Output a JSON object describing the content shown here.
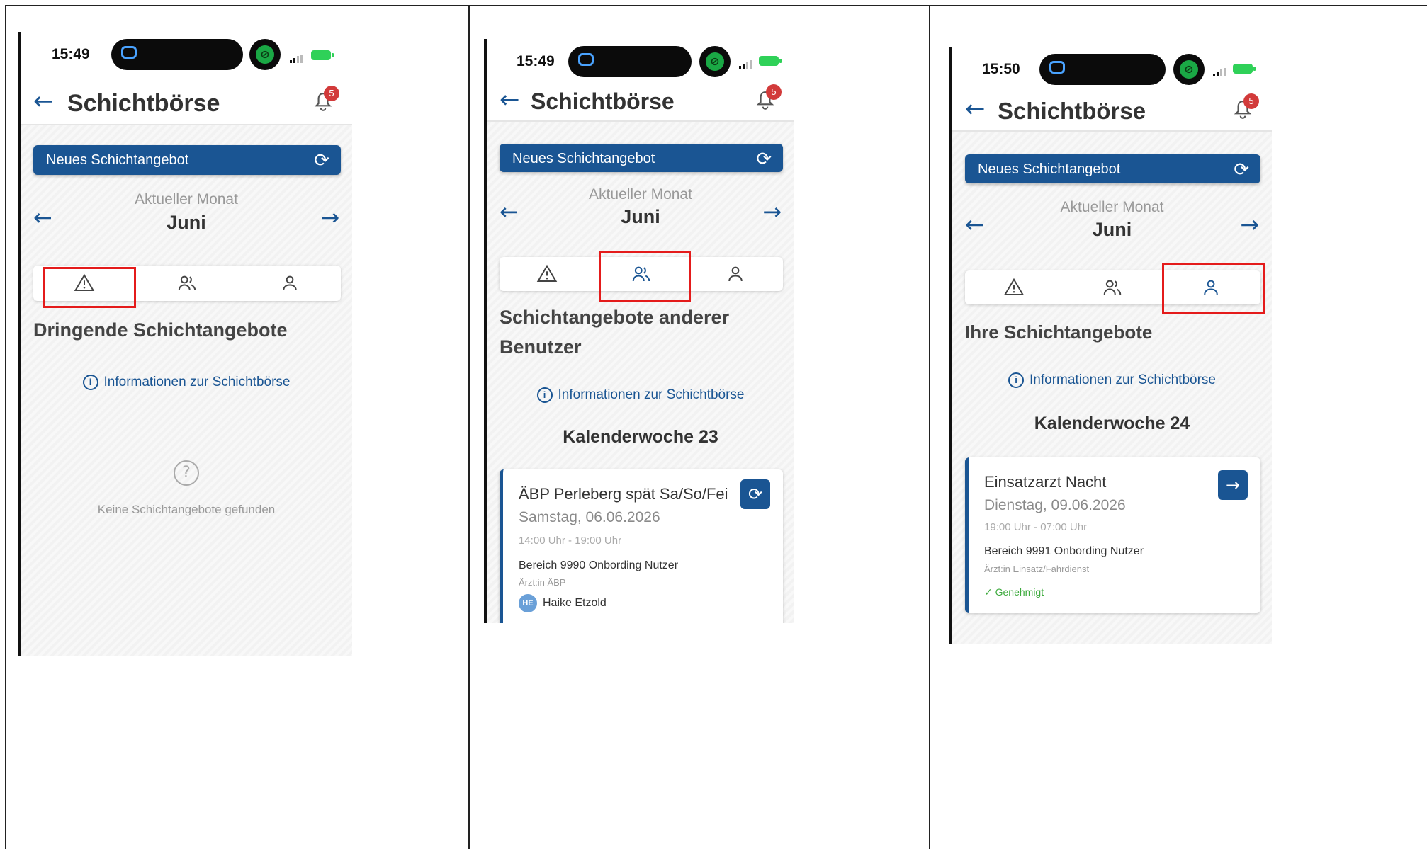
{
  "panels": [
    {
      "status": {
        "time": "15:49"
      },
      "header": {
        "title": "Schichtbörse",
        "badge": "5"
      },
      "new_button": "Neues Schichtangebot",
      "month_caption": "Aktueller Monat",
      "month": "Juni",
      "section_title": "Dringende Schichtangebote",
      "info_link": "Informationen zur Schichtbörse",
      "empty_text": "Keine Schichtangebote gefunden",
      "selected_tab": "urgent"
    },
    {
      "status": {
        "time": "15:49"
      },
      "header": {
        "title": "Schichtbörse",
        "badge": "5"
      },
      "new_button": "Neues Schichtangebot",
      "month_caption": "Aktueller Monat",
      "month": "Juni",
      "section_title_1": "Schichtangebote anderer",
      "section_title_2": "Benutzer",
      "info_link": "Informationen zur Schichtbörse",
      "week": "Kalenderwoche 23",
      "card": {
        "title": "ÄBP Perleberg spät Sa/So/Fei",
        "date": "Samstag, 06.06.2026",
        "time": "14:00 Uhr - 19:00 Uhr",
        "area": "Bereich 9990 Onbording Nutzer",
        "role": "Ärzt:in ÄBP",
        "user_initials": "HE",
        "user_name": "Haike Etzold"
      },
      "selected_tab": "others"
    },
    {
      "status": {
        "time": "15:50"
      },
      "header": {
        "title": "Schichtbörse",
        "badge": "5"
      },
      "new_button": "Neues Schichtangebot",
      "month_caption": "Aktueller Monat",
      "month": "Juni",
      "section_title": "Ihre Schichtangebote",
      "info_link": "Informationen zur Schichtbörse",
      "week": "Kalenderwoche 24",
      "card": {
        "title": "Einsatzarzt Nacht",
        "date": "Dienstag, 09.06.2026",
        "time": "19:00 Uhr - 07:00 Uhr",
        "area": "Bereich 9991 Onbording Nutzer",
        "role": "Ärzt:in Einsatz/Fahrdienst",
        "status": "Genehmigt"
      },
      "selected_tab": "mine"
    }
  ],
  "colors": {
    "accent": "#1a5593",
    "highlight": "#e41b1b",
    "badge": "#d23a3a",
    "approved": "#3daa3d"
  }
}
